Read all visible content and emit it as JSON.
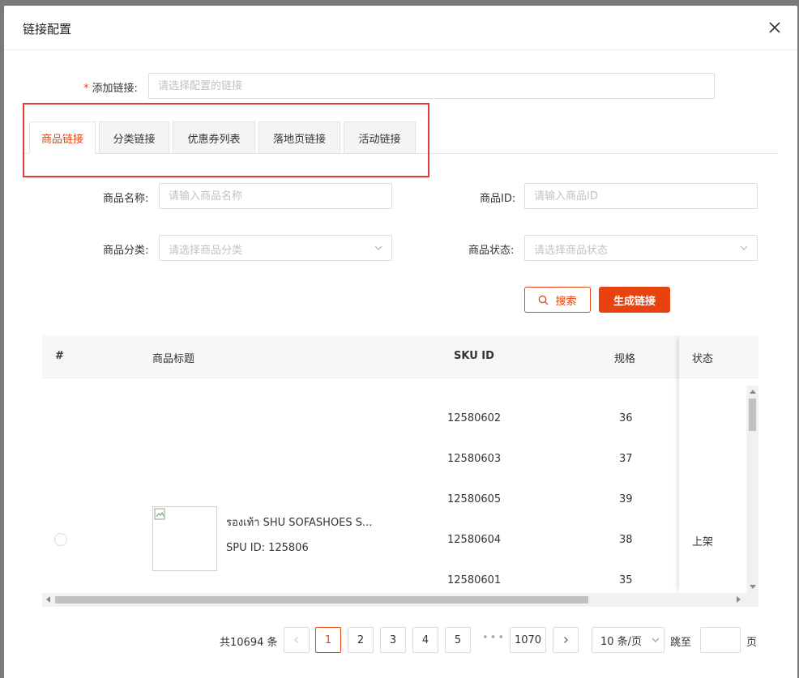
{
  "modal": {
    "title": "链接配置"
  },
  "form": {
    "add_link_label": "添加链接:",
    "add_link_required": "*",
    "add_link_placeholder": "请选择配置的链接"
  },
  "tabs": [
    {
      "label": "商品链接",
      "active": true
    },
    {
      "label": "分类链接",
      "active": false
    },
    {
      "label": "优惠券列表",
      "active": false
    },
    {
      "label": "落地页链接",
      "active": false
    },
    {
      "label": "活动链接",
      "active": false
    }
  ],
  "filters": {
    "product_name_label": "商品名称:",
    "product_name_placeholder": "请输入商品名称",
    "product_id_label": "商品ID:",
    "product_id_placeholder": "请输入商品ID",
    "category_label": "商品分类:",
    "category_placeholder": "请选择商品分类",
    "status_label": "商品状态:",
    "status_placeholder": "请选择商品状态"
  },
  "actions": {
    "search_label": "搜索",
    "generate_label": "生成链接"
  },
  "table": {
    "columns": [
      "#",
      "商品标题",
      "SKU ID",
      "规格",
      "状态"
    ],
    "row": {
      "title": "รองเท้า SHU SOFASHOES S...",
      "spu": "SPU ID: 125806",
      "status": "上架",
      "skus": [
        {
          "sku": "12580602",
          "spec": "36"
        },
        {
          "sku": "12580603",
          "spec": "37"
        },
        {
          "sku": "12580605",
          "spec": "39"
        },
        {
          "sku": "12580604",
          "spec": "38"
        },
        {
          "sku": "12580601",
          "spec": "35"
        }
      ]
    }
  },
  "pagination": {
    "total": "共10694 条",
    "pages": [
      "1",
      "2",
      "3",
      "4",
      "5"
    ],
    "ellipsis": "•••",
    "last_page": "1070",
    "page_size": "10 条/页",
    "jump_label": "跳至",
    "jump_suffix": "页"
  },
  "colors": {
    "accent": "#e8420f",
    "highlight": "#e23b3b"
  }
}
